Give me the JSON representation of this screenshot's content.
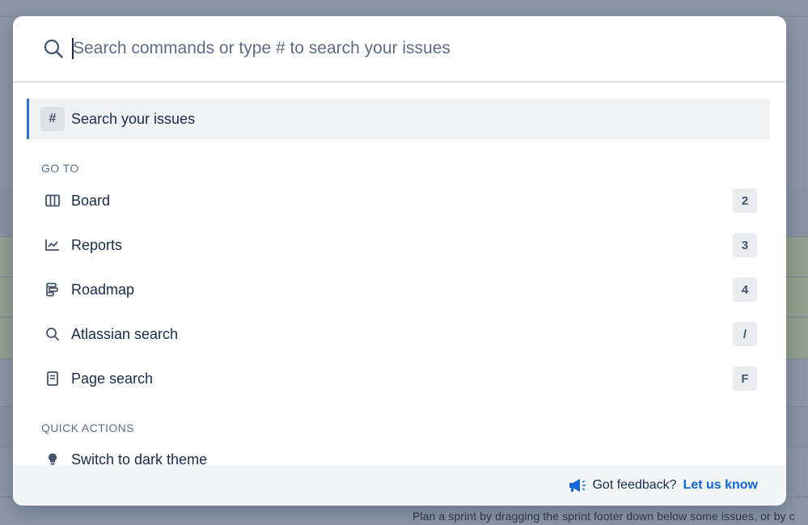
{
  "background": {
    "hint_text": "Plan a sprint by dragging the sprint footer down below some issues, or by c"
  },
  "search": {
    "placeholder": "Search commands or type # to search your issues"
  },
  "selected_item": {
    "badge": "#",
    "label": "Search your issues"
  },
  "go_to": {
    "heading": "GO TO",
    "items": [
      {
        "label": "Board",
        "shortcut": "2",
        "icon": "board-columns-icon"
      },
      {
        "label": "Reports",
        "shortcut": "3",
        "icon": "chart-line-icon"
      },
      {
        "label": "Roadmap",
        "shortcut": "4",
        "icon": "roadmap-icon"
      },
      {
        "label": "Atlassian search",
        "shortcut": "/",
        "icon": "search-icon"
      },
      {
        "label": "Page search",
        "shortcut": "F",
        "icon": "page-icon"
      }
    ]
  },
  "quick_actions": {
    "heading": "QUICK ACTIONS",
    "items": [
      {
        "label": "Switch to dark theme",
        "icon": "lightbulb-icon"
      }
    ]
  },
  "footer": {
    "text": "Got feedback?",
    "link": "Let us know"
  },
  "colors": {
    "accent": "#2f6fde",
    "link": "#0c66e4",
    "text": "#172b4d",
    "muted": "#5e6c84"
  }
}
